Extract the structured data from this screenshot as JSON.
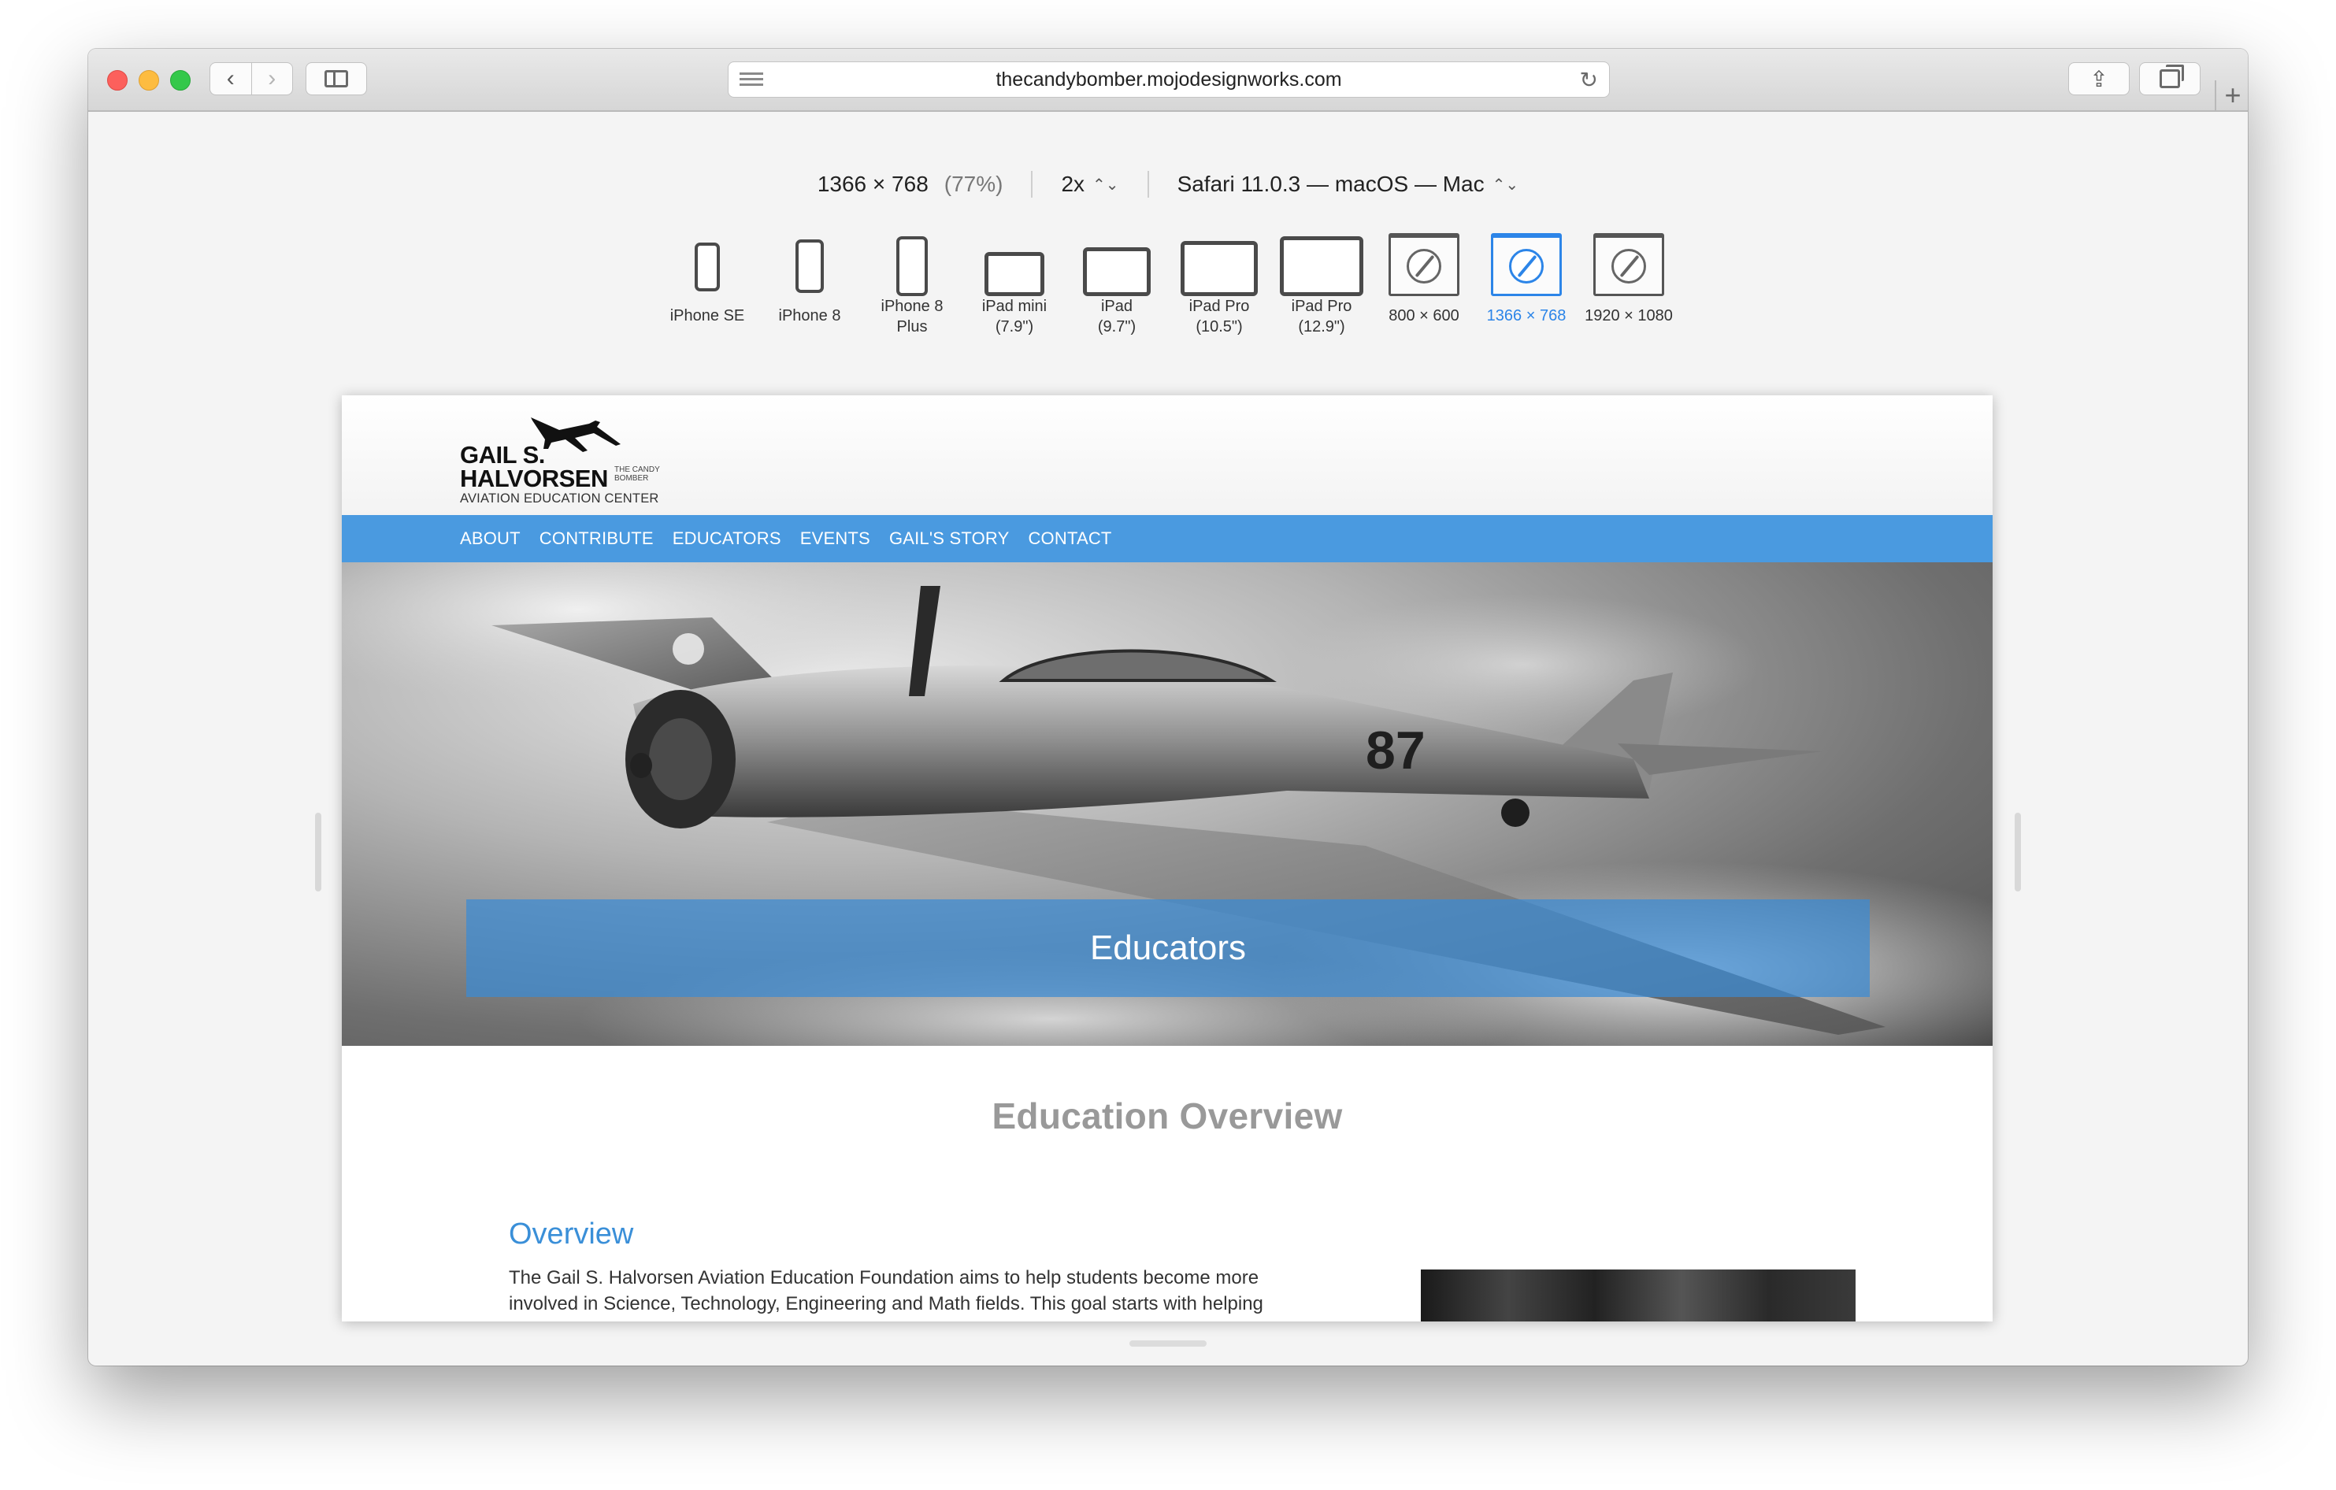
{
  "browser": {
    "url": "thecandybomber.mojodesignworks.com",
    "nav_back": "‹",
    "nav_forward": "›",
    "reload": "↻",
    "share": "⇪",
    "new_tab": "+"
  },
  "rdm": {
    "dimensions": "1366 × 768",
    "zoom": "(77%)",
    "scale": "2x",
    "user_agent": "Safari 11.0.3 — macOS — Mac",
    "devices": [
      {
        "label": "iPhone SE",
        "kind": "phone"
      },
      {
        "label": "iPhone 8",
        "kind": "phone"
      },
      {
        "label": "iPhone 8\nPlus",
        "kind": "phone"
      },
      {
        "label": "iPad mini\n(7.9\")",
        "kind": "tablet"
      },
      {
        "label": "iPad\n(9.7\")",
        "kind": "tablet"
      },
      {
        "label": "iPad Pro\n(10.5\")",
        "kind": "tablet"
      },
      {
        "label": "iPad Pro\n(12.9\")",
        "kind": "tablet"
      },
      {
        "label": "800 × 600",
        "kind": "desktop"
      },
      {
        "label": "1366 × 768",
        "kind": "desktop",
        "selected": true
      },
      {
        "label": "1920 × 1080",
        "kind": "desktop"
      }
    ]
  },
  "site": {
    "logo": {
      "line1": "GAIL S.",
      "line2": "HALVORSEN",
      "tagline": "THE CANDY BOMBER",
      "line3": "AVIATION EDUCATION CENTER"
    },
    "nav": [
      "ABOUT",
      "CONTRIBUTE",
      "EDUCATORS",
      "EVENTS",
      "GAIL'S STORY",
      "CONTACT"
    ],
    "hero_title": "Educators",
    "hero_plane_number": "87",
    "section_title": "Education Overview",
    "overview_heading": "Overview",
    "overview_text": "The Gail S. Halvorsen Aviation Education Foundation aims to help students become more involved in Science, Technology, Engineering and Math fields. This goal starts with helping"
  },
  "colors": {
    "nav_bg": "#4a9ae0",
    "accent": "#3a8fd8",
    "selected_device": "#2c85e8"
  }
}
